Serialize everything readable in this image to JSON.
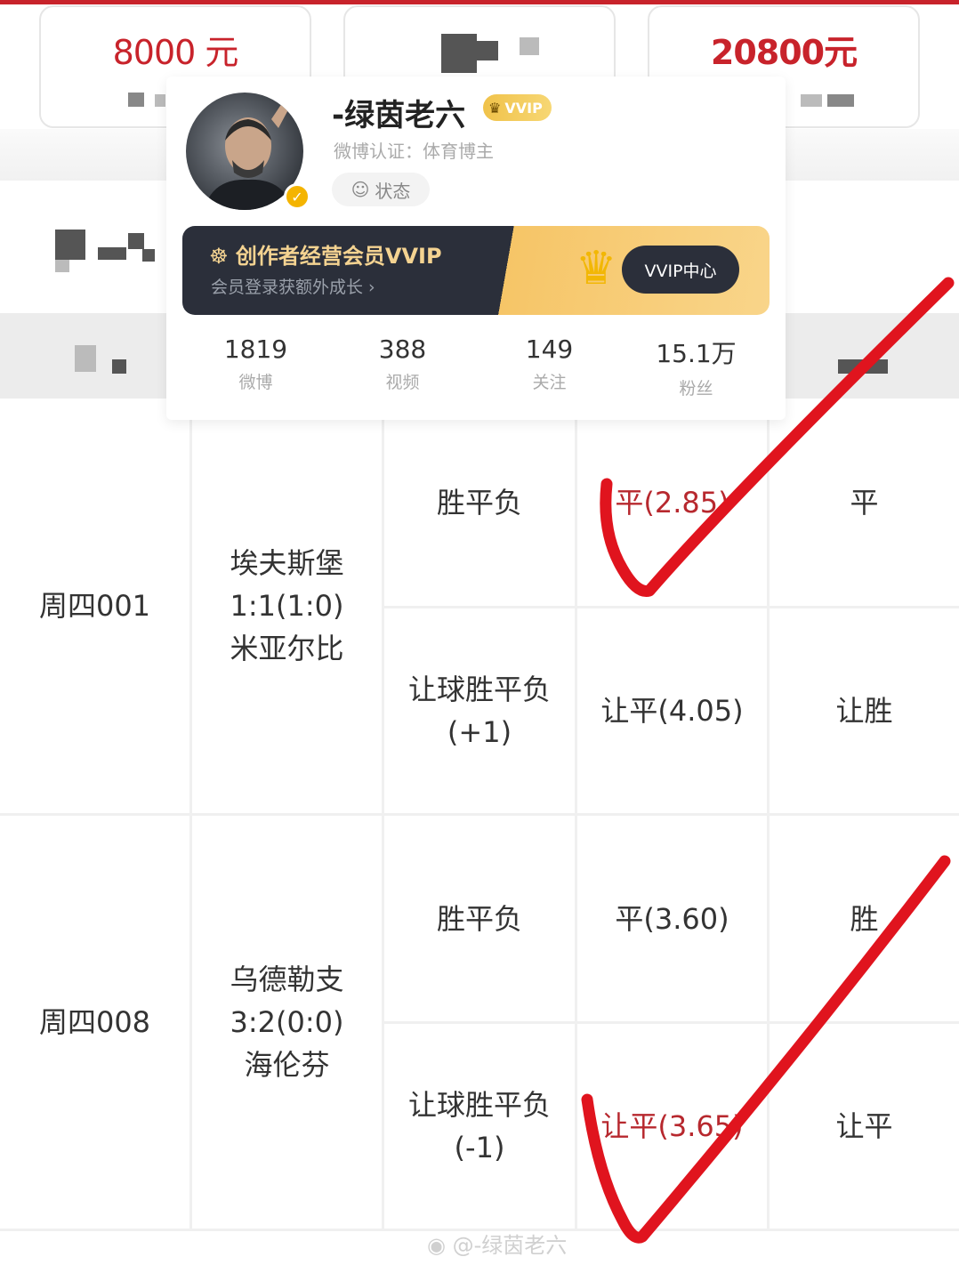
{
  "summary_cards": [
    {
      "amount": "8000 元"
    },
    {
      "amount": ""
    },
    {
      "amount": "20800元"
    }
  ],
  "profile": {
    "username": "-绿茵老六",
    "badge": "VVIP",
    "certification": "微博认证：体育博主",
    "status_label": "状态",
    "banner": {
      "title": "创作者经营会员VVIP",
      "subtitle": "会员登录获额外成长 ›",
      "button": "VVIP中心"
    },
    "stats": [
      {
        "value": "1819",
        "label": "微博"
      },
      {
        "value": "388",
        "label": "视频"
      },
      {
        "value": "149",
        "label": "关注"
      },
      {
        "value": "15.1万",
        "label": "粉丝"
      }
    ]
  },
  "matches": [
    {
      "id": "周四001",
      "home": "埃夫斯堡",
      "score": "1:1(1:0)",
      "away": "米亚尔比",
      "bets": [
        {
          "type": "胜平负",
          "type_extra": "",
          "pick": "平(2.85)",
          "result": "平",
          "hit": true
        },
        {
          "type": "让球胜平负",
          "type_extra": "(+1)",
          "pick": "让平(4.05)",
          "result": "让胜",
          "hit": false
        }
      ]
    },
    {
      "id": "周四008",
      "home": "乌德勒支",
      "score": "3:2(0:0)",
      "away": "海伦芬",
      "bets": [
        {
          "type": "胜平负",
          "type_extra": "",
          "pick": "平(3.60)",
          "result": "胜",
          "hit": false
        },
        {
          "type": "让球胜平负",
          "type_extra": "(-1)",
          "pick": "让平(3.65)",
          "result": "让平",
          "hit": true
        }
      ]
    }
  ],
  "watermark": "@-绿茵老六",
  "colors": {
    "accent_red": "#c8232b",
    "hit_text": "#b7282e",
    "check_mark": "#e0141e",
    "vvip_gold": "#f0c24a"
  }
}
